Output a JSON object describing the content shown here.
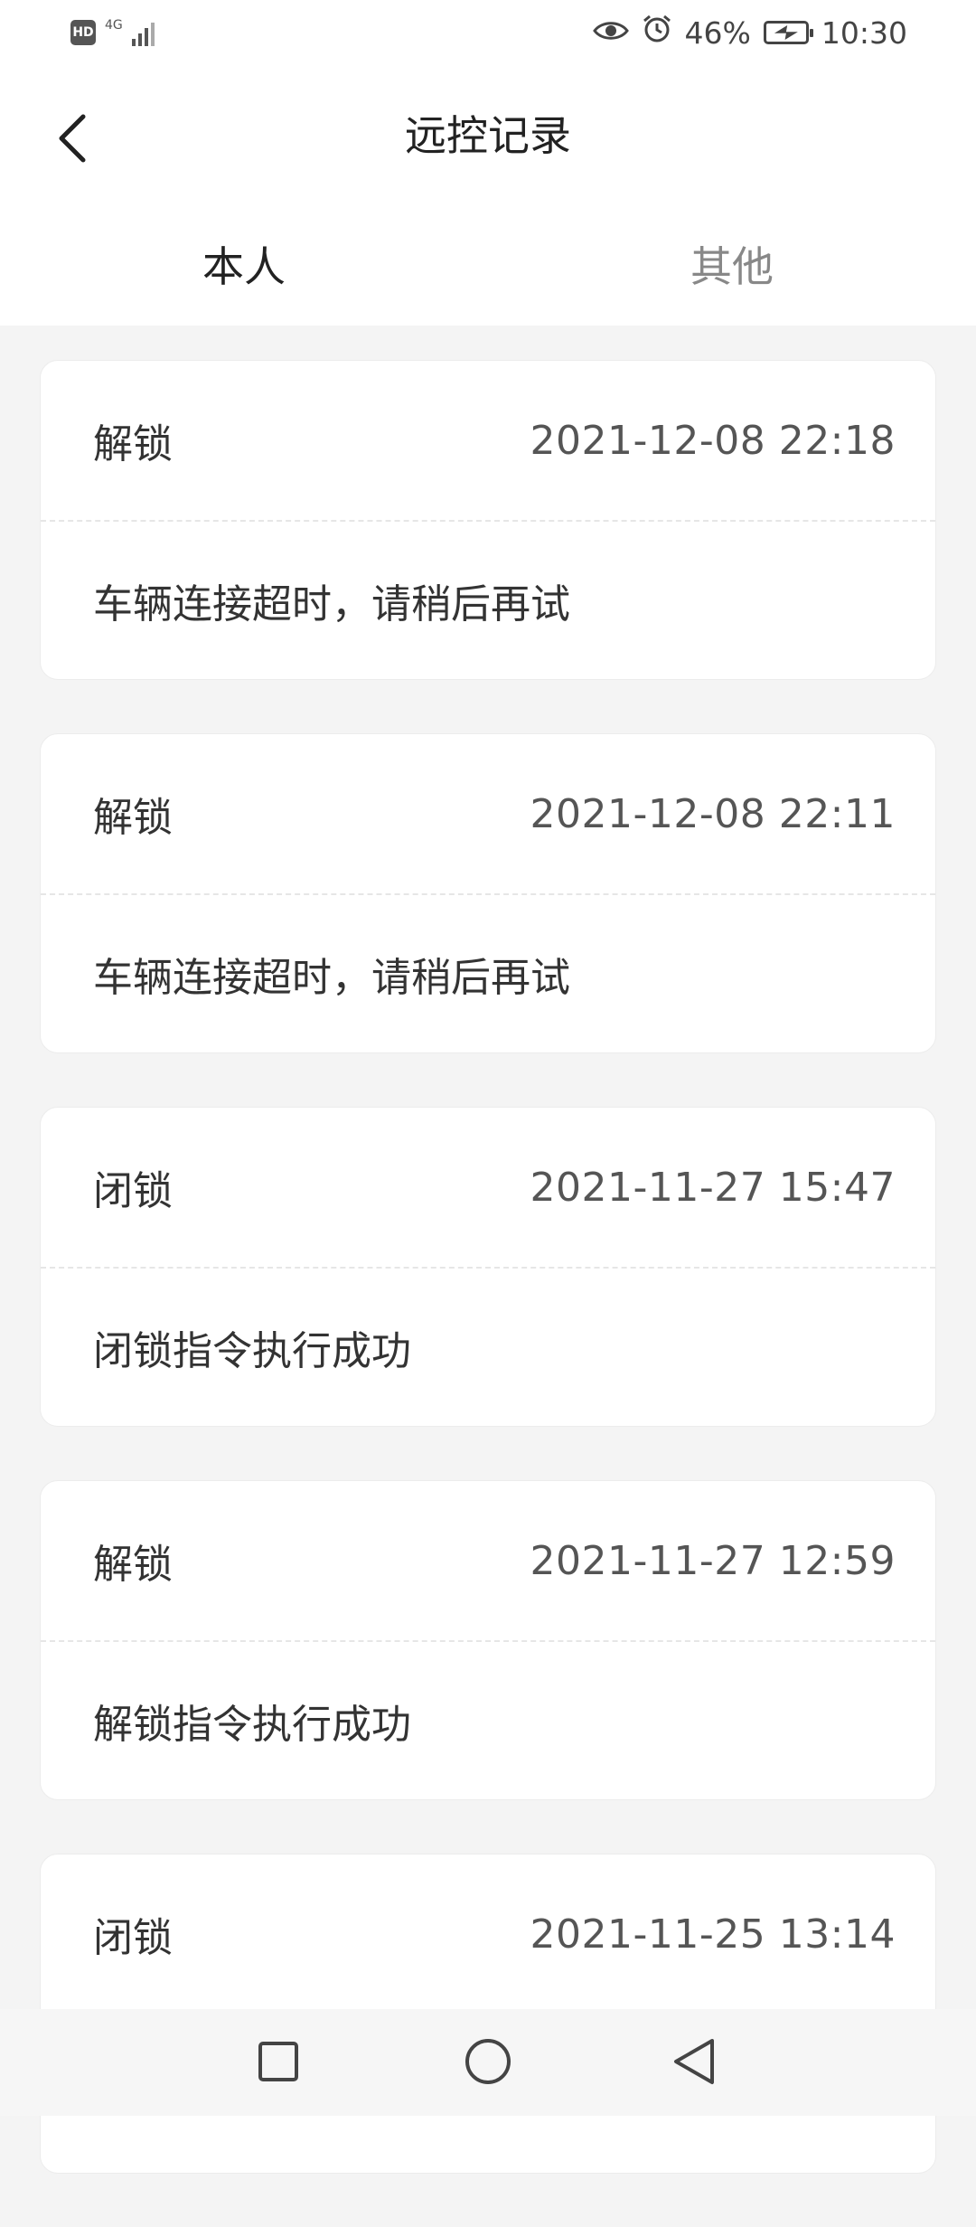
{
  "status_bar": {
    "hd_badge": "HD",
    "network": "4G",
    "battery_percent": "46%",
    "time": "10:30",
    "icons": [
      "hd-icon",
      "signal-icon",
      "eye-icon",
      "alarm-icon",
      "battery-charging-icon"
    ]
  },
  "header": {
    "title": "远控记录",
    "back_icon": "chevron-left-icon"
  },
  "tabs": [
    {
      "label": "本人",
      "active": true
    },
    {
      "label": "其他",
      "active": false
    }
  ],
  "records": [
    {
      "action": "解锁",
      "time": "2021-12-08 22:18",
      "result": "车辆连接超时，请稍后再试"
    },
    {
      "action": "解锁",
      "time": "2021-12-08 22:11",
      "result": "车辆连接超时，请稍后再试"
    },
    {
      "action": "闭锁",
      "time": "2021-11-27 15:47",
      "result": "闭锁指令执行成功"
    },
    {
      "action": "解锁",
      "time": "2021-11-27 12:59",
      "result": "解锁指令执行成功"
    },
    {
      "action": "闭锁",
      "time": "2021-11-25 13:14",
      "result": ""
    }
  ],
  "system_nav": {
    "icons": [
      "square-recents-icon",
      "circle-home-icon",
      "triangle-back-icon"
    ]
  },
  "colors": {
    "page_background": "#f4f4f4",
    "card_background": "#ffffff",
    "text_primary": "#333333",
    "text_secondary": "#888888"
  }
}
